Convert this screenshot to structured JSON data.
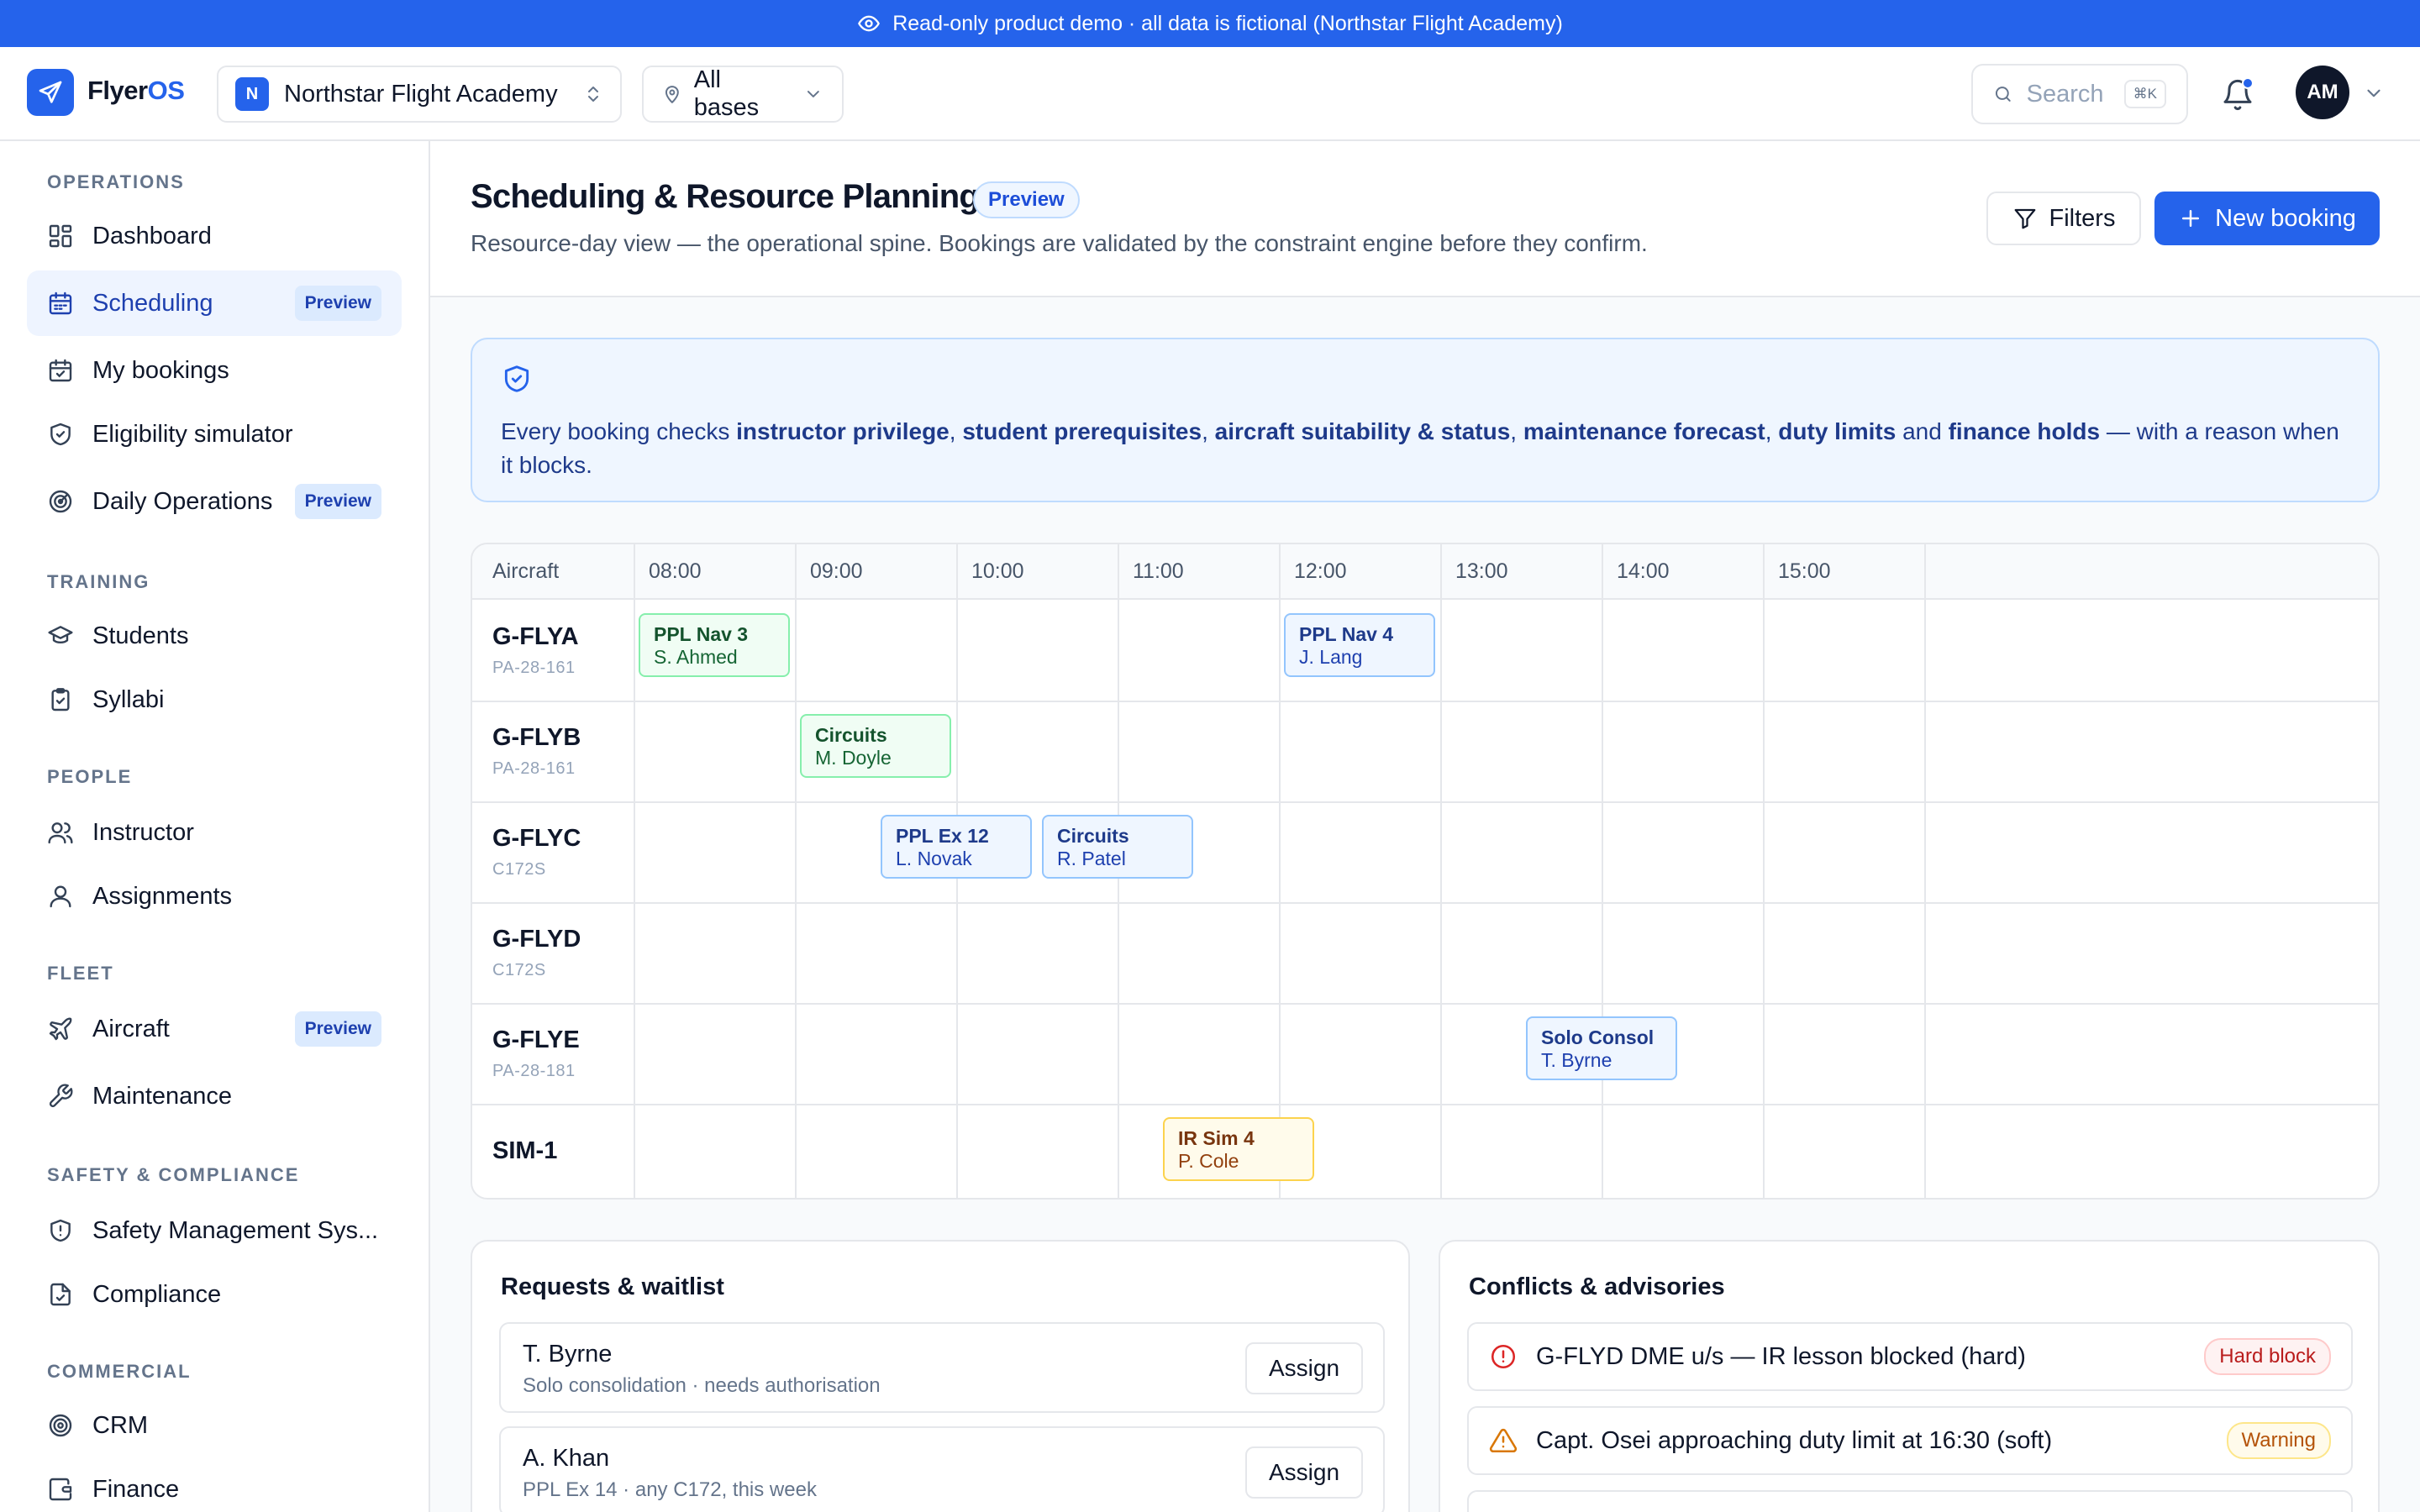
{
  "banner": {
    "text": "Read-only product demo · all data is fictional (Northstar Flight Academy)"
  },
  "topbar": {
    "brand_main": "Flyer",
    "brand_accent": "OS",
    "org_initial": "N",
    "org_name": "Northstar Flight Academy",
    "base_label": "All bases",
    "search_placeholder": "Search",
    "search_shortcut": "⌘K",
    "user_initials": "AM",
    "has_notification": true
  },
  "sidebar": {
    "sections": [
      {
        "title": "OPERATIONS",
        "items": [
          {
            "label": "Dashboard",
            "icon": "dashboard-icon"
          },
          {
            "label": "Scheduling",
            "icon": "calendar-icon",
            "tag": "Preview",
            "active": true
          },
          {
            "label": "My bookings",
            "icon": "calendar-check-icon"
          },
          {
            "label": "Eligibility simulator",
            "icon": "shield-check-icon"
          },
          {
            "label": "Daily Operations",
            "icon": "radar-icon",
            "tag": "Preview"
          }
        ]
      },
      {
        "title": "TRAINING",
        "items": [
          {
            "label": "Students",
            "icon": "graduation-cap-icon"
          },
          {
            "label": "Syllabi",
            "icon": "clipboard-icon"
          }
        ]
      },
      {
        "title": "PEOPLE",
        "items": [
          {
            "label": "Instructor",
            "icon": "users-icon"
          },
          {
            "label": "Assignments",
            "icon": "user-icon"
          }
        ]
      },
      {
        "title": "FLEET",
        "items": [
          {
            "label": "Aircraft",
            "icon": "plane-icon",
            "tag": "Preview"
          },
          {
            "label": "Maintenance",
            "icon": "wrench-icon"
          }
        ]
      },
      {
        "title": "SAFETY & COMPLIANCE",
        "items": [
          {
            "label": "Safety Management Sys...",
            "icon": "shield-alert-icon"
          },
          {
            "label": "Compliance",
            "icon": "file-check-icon"
          }
        ]
      },
      {
        "title": "COMMERCIAL",
        "items": [
          {
            "label": "CRM",
            "icon": "target-icon"
          },
          {
            "label": "Finance",
            "icon": "wallet-icon"
          }
        ]
      }
    ]
  },
  "page": {
    "title": "Scheduling & Resource Planning",
    "title_tag": "Preview",
    "subtitle": "Resource-day view — the operational spine. Bookings are validated by the constraint engine before they confirm.",
    "filters_label": "Filters",
    "new_booking_label": "New booking"
  },
  "info": {
    "parts": [
      {
        "text": "Every booking checks ",
        "bold": false
      },
      {
        "text": "instructor privilege",
        "bold": true
      },
      {
        "text": ", ",
        "bold": false
      },
      {
        "text": "student prerequisites",
        "bold": true
      },
      {
        "text": ", ",
        "bold": false
      },
      {
        "text": "aircraft suitability & status",
        "bold": true
      },
      {
        "text": ", ",
        "bold": false
      },
      {
        "text": "maintenance forecast",
        "bold": true
      },
      {
        "text": ", ",
        "bold": false
      },
      {
        "text": "duty limits",
        "bold": true
      },
      {
        "text": " and ",
        "bold": false
      },
      {
        "text": "finance holds",
        "bold": true
      },
      {
        "text": " — with a reason when it blocks.",
        "bold": false
      }
    ]
  },
  "schedule": {
    "resource_header": "Aircraft",
    "hours": [
      "08:00",
      "09:00",
      "10:00",
      "11:00",
      "12:00",
      "13:00",
      "14:00",
      "15:00"
    ],
    "rows": [
      {
        "reg": "G-FLYA",
        "type": "PA-28-161"
      },
      {
        "reg": "G-FLYB",
        "type": "PA-28-161"
      },
      {
        "reg": "G-FLYC",
        "type": "C172S"
      },
      {
        "reg": "G-FLYD",
        "type": "C172S"
      },
      {
        "reg": "G-FLYE",
        "type": "PA-28-181"
      },
      {
        "reg": "SIM-1",
        "type": ""
      }
    ],
    "bookings": [
      {
        "row": 0,
        "start": "08:00",
        "title": "PPL Nav 3",
        "person": "S. Ahmed",
        "status": "green"
      },
      {
        "row": 0,
        "start": "12:00",
        "title": "PPL Nav 4",
        "person": "J. Lang",
        "status": "blue"
      },
      {
        "row": 1,
        "start": "09:00",
        "title": "Circuits",
        "person": "M. Doyle",
        "status": "green"
      },
      {
        "row": 2,
        "start": "09:30",
        "title": "PPL Ex 12",
        "person": "L. Novak",
        "status": "blue"
      },
      {
        "row": 2,
        "start": "10:30",
        "title": "Circuits",
        "person": "R. Patel",
        "status": "blue"
      },
      {
        "row": 4,
        "start": "13:30",
        "title": "Solo Consol",
        "person": "T. Byrne",
        "status": "blue"
      },
      {
        "row": 5,
        "start": "11:15",
        "title": "IR Sim 4",
        "person": "P. Cole",
        "status": "amber"
      }
    ]
  },
  "requests": {
    "title": "Requests & waitlist",
    "items": [
      {
        "name": "T. Byrne",
        "detail": "Solo consolidation · needs authorisation",
        "action": "Assign"
      },
      {
        "name": "A. Khan",
        "detail": "PPL Ex 14 · any C172, this week",
        "action": "Assign"
      }
    ]
  },
  "conflicts": {
    "title": "Conflicts & advisories",
    "items": [
      {
        "text": "G-FLYD DME u/s — IR lesson blocked (hard)",
        "badge": "Hard block",
        "severity": "error",
        "icon": "alert-circle-icon"
      },
      {
        "text": "Capt. Osei approaching duty limit at 16:30 (soft)",
        "badge": "Warning",
        "severity": "warning",
        "icon": "alert-triangle-icon"
      }
    ]
  },
  "colors": {
    "accent": "#2563eb",
    "booking_green": "#86efac",
    "booking_blue": "#93c5fd",
    "booking_amber": "#fcd34d",
    "hard_block": "#b91c1c",
    "warning": "#b45309"
  }
}
